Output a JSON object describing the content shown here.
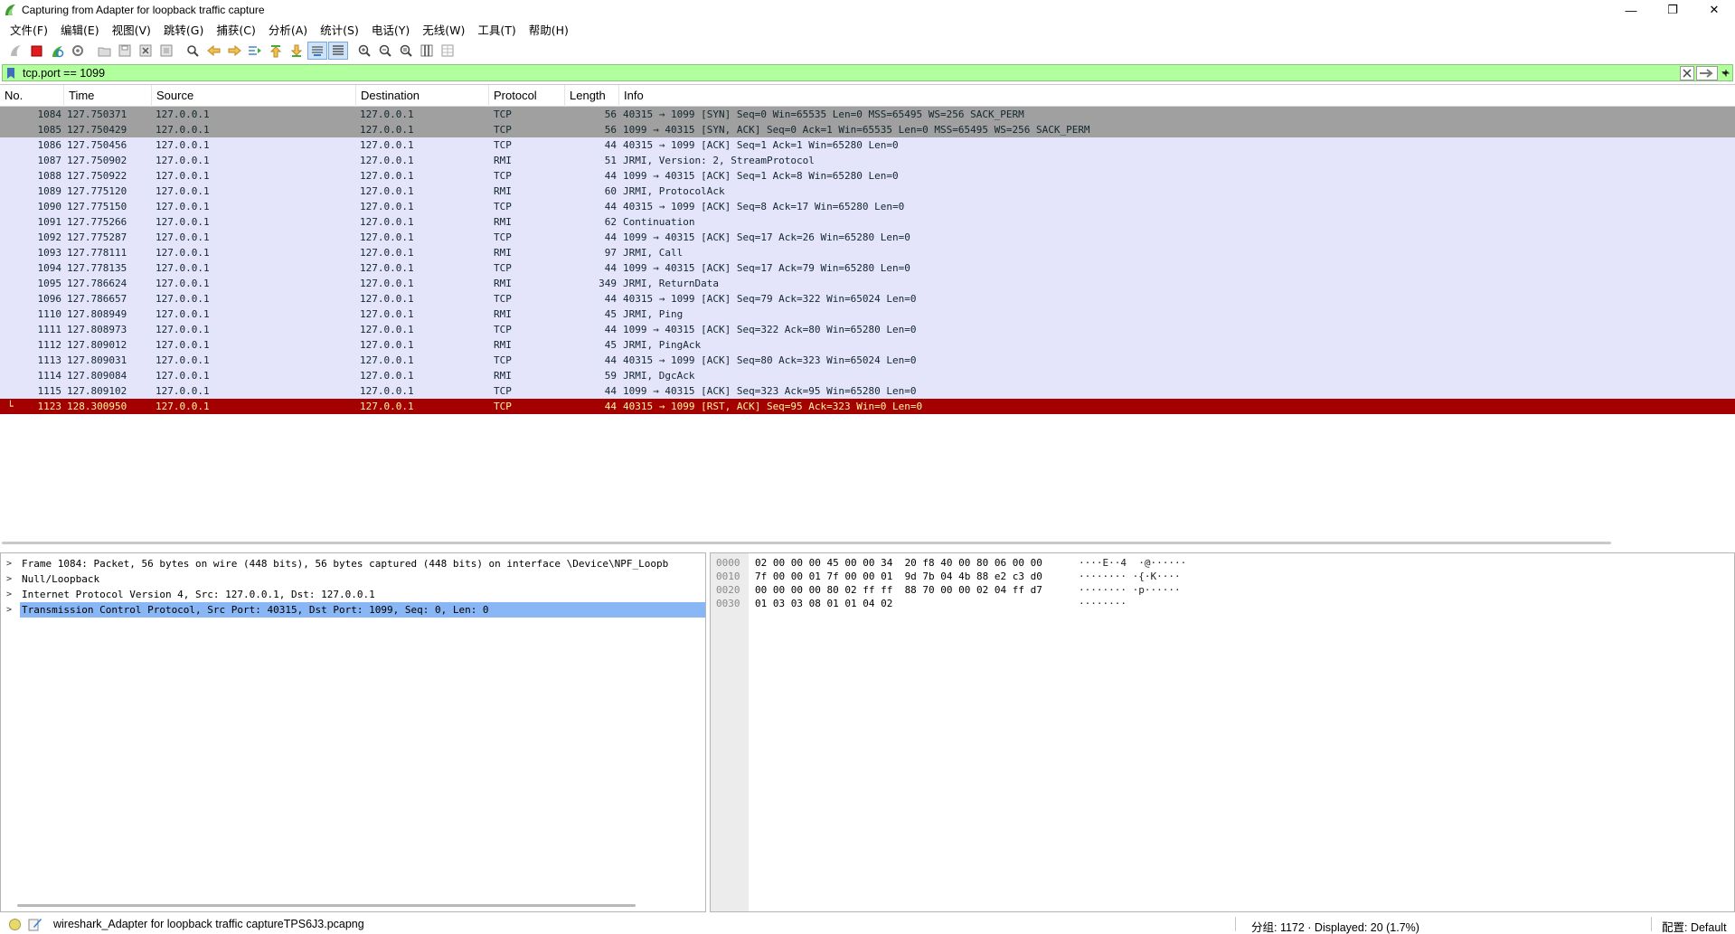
{
  "window": {
    "title": "Capturing from Adapter for loopback traffic capture",
    "buttons": [
      "—",
      "❐",
      "✕"
    ]
  },
  "menu": [
    "文件(F)",
    "编辑(E)",
    "视图(V)",
    "跳转(G)",
    "捕获(C)",
    "分析(A)",
    "统计(S)",
    "电话(Y)",
    "无线(W)",
    "工具(T)",
    "帮助(H)"
  ],
  "toolbar_icons": [
    "start-capture-icon",
    "stop-capture-icon",
    "restart-capture-icon",
    "capture-options-icon",
    "open-file-icon",
    "save-file-icon",
    "close-file-icon",
    "reload-file-icon",
    "find-packet-icon",
    "go-back-icon",
    "go-forward-icon",
    "go-to-packet-icon",
    "go-first-icon",
    "go-last-icon",
    "auto-scroll-icon",
    "colorize-icon",
    "zoom-in-icon",
    "zoom-out-icon",
    "zoom-normal-icon",
    "resize-columns-icon",
    "layout-icon"
  ],
  "filter": {
    "value": "tcp.port == 1099",
    "add_label": "+"
  },
  "packet_list": {
    "columns": [
      "No.",
      "Time",
      "Source",
      "Destination",
      "Protocol",
      "Length",
      "Info"
    ],
    "rows": [
      {
        "no": "1084",
        "time": "127.750371",
        "src": "127.0.0.1",
        "dst": "127.0.0.1",
        "proto": "TCP",
        "len": "56",
        "info": "40315 → 1099 [SYN] Seq=0 Win=65535 Len=0 MSS=65495 WS=256 SACK_PERM",
        "style": "syn"
      },
      {
        "no": "1085",
        "time": "127.750429",
        "src": "127.0.0.1",
        "dst": "127.0.0.1",
        "proto": "TCP",
        "len": "56",
        "info": "1099 → 40315 [SYN, ACK] Seq=0 Ack=1 Win=65535 Len=0 MSS=65495 WS=256 SACK_PERM",
        "style": "syn"
      },
      {
        "no": "1086",
        "time": "127.750456",
        "src": "127.0.0.1",
        "dst": "127.0.0.1",
        "proto": "TCP",
        "len": "44",
        "info": "40315 → 1099 [ACK] Seq=1 Ack=1 Win=65280 Len=0",
        "style": "rmi"
      },
      {
        "no": "1087",
        "time": "127.750902",
        "src": "127.0.0.1",
        "dst": "127.0.0.1",
        "proto": "RMI",
        "len": "51",
        "info": "JRMI, Version: 2, StreamProtocol",
        "style": "rmi"
      },
      {
        "no": "1088",
        "time": "127.750922",
        "src": "127.0.0.1",
        "dst": "127.0.0.1",
        "proto": "TCP",
        "len": "44",
        "info": "1099 → 40315 [ACK] Seq=1 Ack=8 Win=65280 Len=0",
        "style": "rmi"
      },
      {
        "no": "1089",
        "time": "127.775120",
        "src": "127.0.0.1",
        "dst": "127.0.0.1",
        "proto": "RMI",
        "len": "60",
        "info": "JRMI, ProtocolAck",
        "style": "rmi"
      },
      {
        "no": "1090",
        "time": "127.775150",
        "src": "127.0.0.1",
        "dst": "127.0.0.1",
        "proto": "TCP",
        "len": "44",
        "info": "40315 → 1099 [ACK] Seq=8 Ack=17 Win=65280 Len=0",
        "style": "rmi"
      },
      {
        "no": "1091",
        "time": "127.775266",
        "src": "127.0.0.1",
        "dst": "127.0.0.1",
        "proto": "RMI",
        "len": "62",
        "info": "Continuation",
        "style": "rmi"
      },
      {
        "no": "1092",
        "time": "127.775287",
        "src": "127.0.0.1",
        "dst": "127.0.0.1",
        "proto": "TCP",
        "len": "44",
        "info": "1099 → 40315 [ACK] Seq=17 Ack=26 Win=65280 Len=0",
        "style": "rmi"
      },
      {
        "no": "1093",
        "time": "127.778111",
        "src": "127.0.0.1",
        "dst": "127.0.0.1",
        "proto": "RMI",
        "len": "97",
        "info": "JRMI, Call",
        "style": "rmi"
      },
      {
        "no": "1094",
        "time": "127.778135",
        "src": "127.0.0.1",
        "dst": "127.0.0.1",
        "proto": "TCP",
        "len": "44",
        "info": "1099 → 40315 [ACK] Seq=17 Ack=79 Win=65280 Len=0",
        "style": "rmi"
      },
      {
        "no": "1095",
        "time": "127.786624",
        "src": "127.0.0.1",
        "dst": "127.0.0.1",
        "proto": "RMI",
        "len": "349",
        "info": "JRMI, ReturnData",
        "style": "rmi"
      },
      {
        "no": "1096",
        "time": "127.786657",
        "src": "127.0.0.1",
        "dst": "127.0.0.1",
        "proto": "TCP",
        "len": "44",
        "info": "40315 → 1099 [ACK] Seq=79 Ack=322 Win=65024 Len=0",
        "style": "rmi"
      },
      {
        "no": "1110",
        "time": "127.808949",
        "src": "127.0.0.1",
        "dst": "127.0.0.1",
        "proto": "RMI",
        "len": "45",
        "info": "JRMI, Ping",
        "style": "rmi"
      },
      {
        "no": "1111",
        "time": "127.808973",
        "src": "127.0.0.1",
        "dst": "127.0.0.1",
        "proto": "TCP",
        "len": "44",
        "info": "1099 → 40315 [ACK] Seq=322 Ack=80 Win=65280 Len=0",
        "style": "rmi"
      },
      {
        "no": "1112",
        "time": "127.809012",
        "src": "127.0.0.1",
        "dst": "127.0.0.1",
        "proto": "RMI",
        "len": "45",
        "info": "JRMI, PingAck",
        "style": "rmi"
      },
      {
        "no": "1113",
        "time": "127.809031",
        "src": "127.0.0.1",
        "dst": "127.0.0.1",
        "proto": "TCP",
        "len": "44",
        "info": "40315 → 1099 [ACK] Seq=80 Ack=323 Win=65024 Len=0",
        "style": "rmi"
      },
      {
        "no": "1114",
        "time": "127.809084",
        "src": "127.0.0.1",
        "dst": "127.0.0.1",
        "proto": "RMI",
        "len": "59",
        "info": "JRMI, DgcAck",
        "style": "rmi"
      },
      {
        "no": "1115",
        "time": "127.809102",
        "src": "127.0.0.1",
        "dst": "127.0.0.1",
        "proto": "TCP",
        "len": "44",
        "info": "1099 → 40315 [ACK] Seq=323 Ack=95 Win=65280 Len=0",
        "style": "rmi"
      },
      {
        "no": "1123",
        "time": "128.300950",
        "src": "127.0.0.1",
        "dst": "127.0.0.1",
        "proto": "TCP",
        "len": "44",
        "info": "40315 → 1099 [RST, ACK] Seq=95 Ack=323 Win=0 Len=0",
        "style": "rst"
      }
    ]
  },
  "details": [
    {
      "text": "Frame 1084: Packet, 56 bytes on wire (448 bits), 56 bytes captured (448 bits) on interface \\Device\\NPF_Loopb",
      "selected": false
    },
    {
      "text": "Null/Loopback",
      "selected": false
    },
    {
      "text": "Internet Protocol Version 4, Src: 127.0.0.1, Dst: 127.0.0.1",
      "selected": false
    },
    {
      "text": "Transmission Control Protocol, Src Port: 40315, Dst Port: 1099, Seq: 0, Len: 0",
      "selected": true
    }
  ],
  "bytes": [
    {
      "offset": "0000",
      "hex": "02 00 00 00 45 00 00 34  20 f8 40 00 80 06 00 00",
      "ascii": "····E··4  ·@······"
    },
    {
      "offset": "0010",
      "hex": "7f 00 00 01 7f 00 00 01  9d 7b 04 4b 88 e2 c3 d0",
      "ascii": "········ ·{·K····"
    },
    {
      "offset": "0020",
      "hex": "00 00 00 00 80 02 ff ff  88 70 00 00 02 04 ff d7",
      "ascii": "········ ·p······"
    },
    {
      "offset": "0030",
      "hex": "01 03 03 08 01 01 04 02",
      "ascii": "········"
    }
  ],
  "status": {
    "file": "wireshark_Adapter for loopback traffic captureTPS6J3.pcapng",
    "packets": "分组: 1172 · Displayed: 20 (1.7%)",
    "profile": "配置: Default"
  },
  "colors": {
    "filter_valid": "#b1ff9d",
    "syn_row": "#a0a0a0",
    "default_row": "#e4e4fb",
    "rst_row": "#a40000",
    "rst_text": "#fffc9c",
    "detail_selected": "#89b6f5"
  }
}
